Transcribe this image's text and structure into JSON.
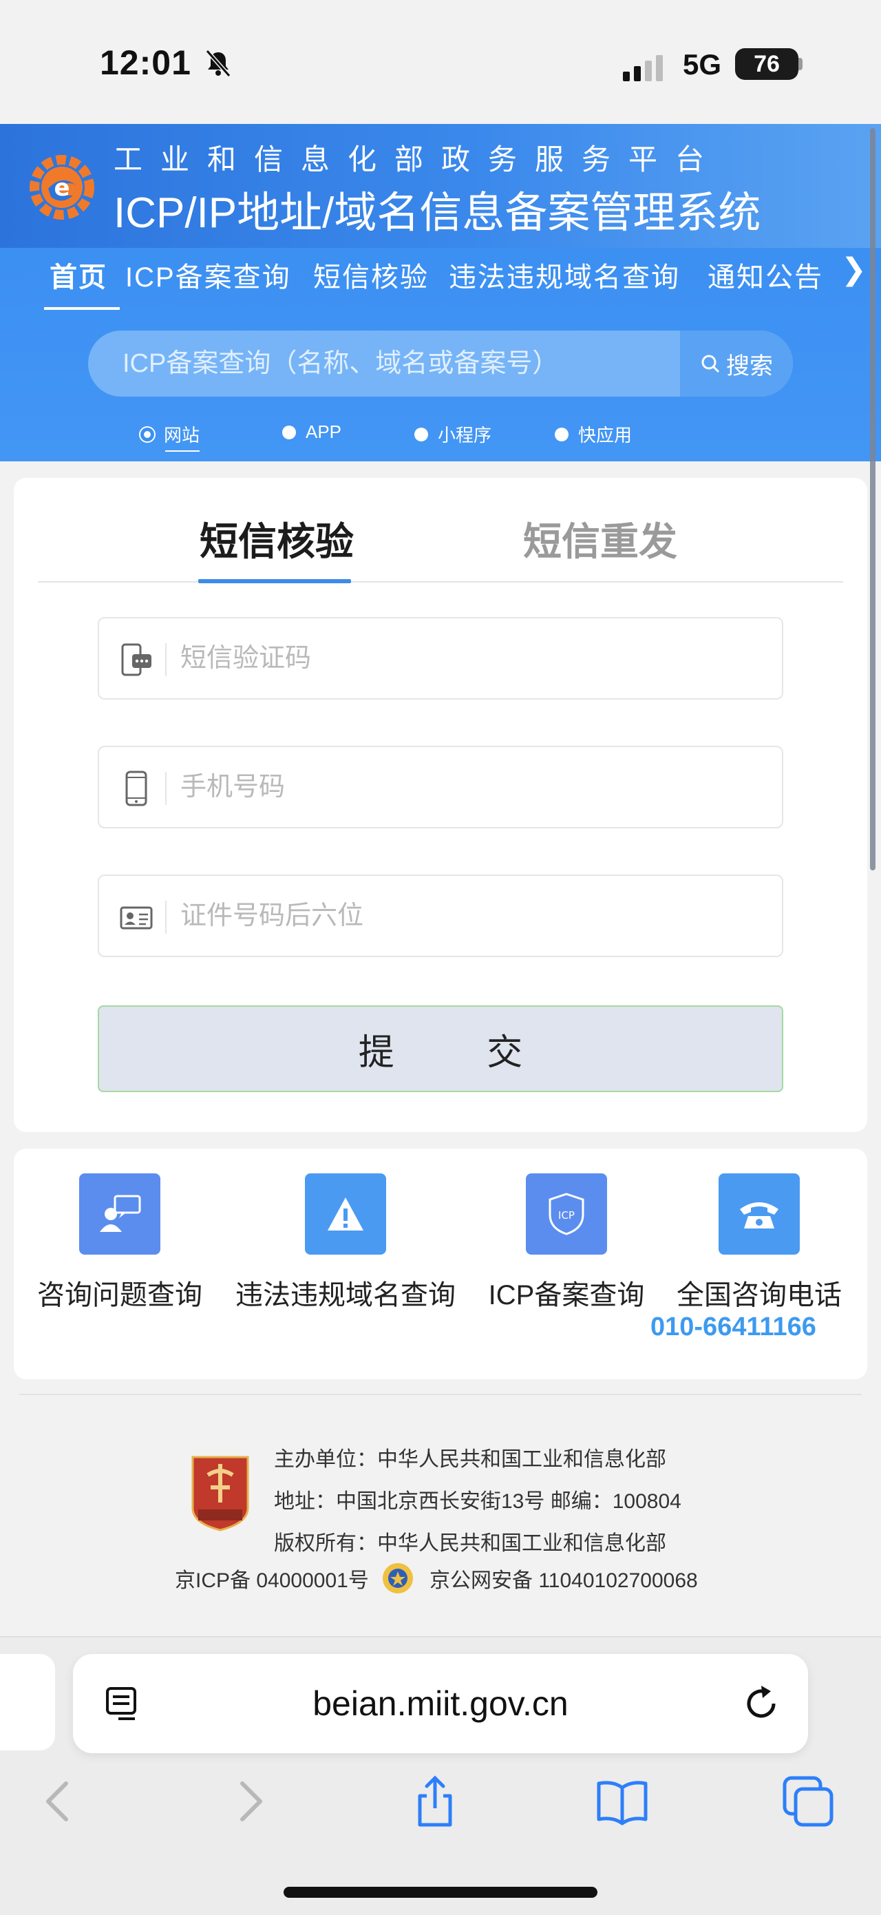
{
  "status_bar": {
    "time": "12:01",
    "network": "5G",
    "battery": "76"
  },
  "header": {
    "subtitle": "工业和信息化部政务服务平台",
    "title": "ICP/IP地址/域名信息备案管理系统",
    "nav": [
      "首页",
      "ICP备案查询",
      "短信核验",
      "违法违规域名查询",
      "通知公告"
    ],
    "nav_more_icon": "chevron-right-icon",
    "search": {
      "placeholder": "ICP备案查询（名称、域名或备案号）",
      "button": "搜索"
    },
    "search_types": [
      "网站",
      "APP",
      "小程序",
      "快应用"
    ],
    "search_type_selected": "网站",
    "colors": {
      "primary": "#3b8ff2",
      "accent_link": "#3d9aef"
    }
  },
  "form": {
    "tabs": {
      "active": "短信核验",
      "inactive": "短信重发"
    },
    "fields": {
      "sms_code_placeholder": "短信验证码",
      "phone_placeholder": "手机号码",
      "id_last6_placeholder": "证件号码后六位"
    },
    "submit": "提 交"
  },
  "services": [
    {
      "label": "咨询问题查询",
      "icon": "consult-icon",
      "color": "#5b8def"
    },
    {
      "label": "违法违规域名查询",
      "icon": "warning-icon",
      "color": "#4a9af2"
    },
    {
      "label": "ICP备案查询",
      "icon": "shield-icon",
      "color": "#5b8def"
    },
    {
      "label": "全国咨询电话",
      "icon": "telephone-icon",
      "color": "#4a9af2"
    }
  ],
  "phone_number": "010-66411166",
  "footer": {
    "sponsor": "主办单位：中华人民共和国工业和信息化部",
    "address": "地址：中国北京西长安街13号 邮编：100804",
    "copyright": "版权所有：中华人民共和国工业和信息化部",
    "icp": "京ICP备 04000001号",
    "police": "京公网安备 11040102700068"
  },
  "browser": {
    "url": "beian.miit.gov.cn"
  }
}
